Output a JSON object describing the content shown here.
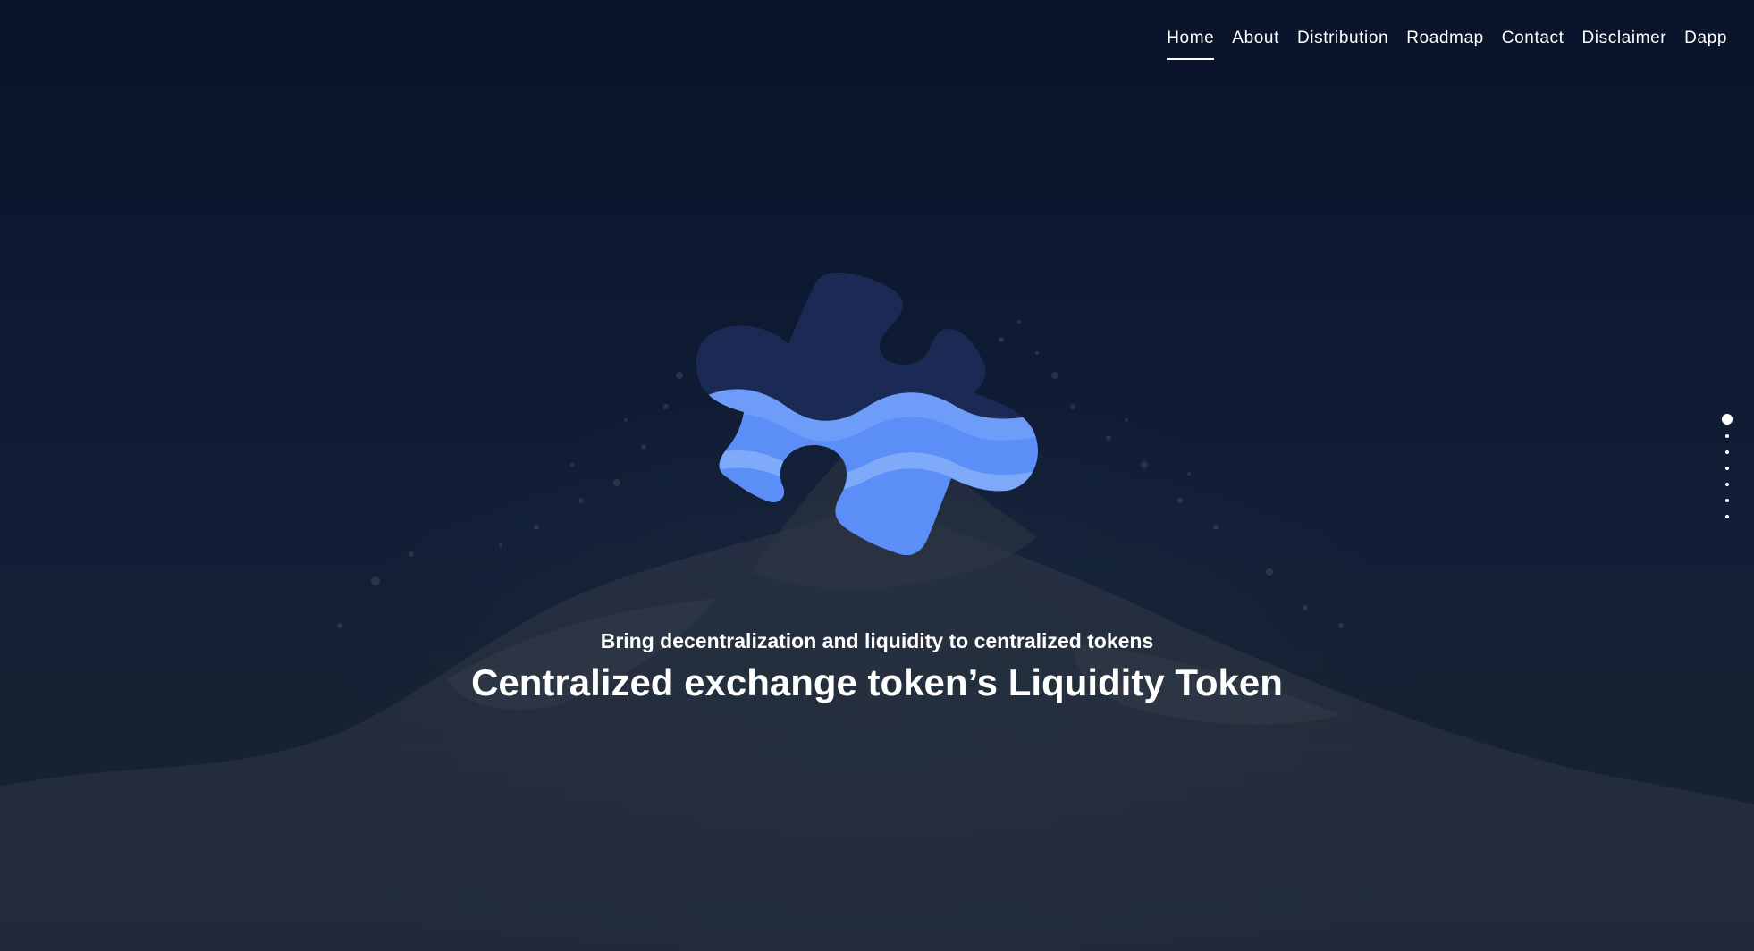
{
  "nav": {
    "items": [
      {
        "label": "Home",
        "active": true
      },
      {
        "label": "About"
      },
      {
        "label": "Distribution"
      },
      {
        "label": "Roadmap"
      },
      {
        "label": "Contact"
      },
      {
        "label": "Disclaimer"
      },
      {
        "label": "Dapp"
      }
    ]
  },
  "hero": {
    "subtitle": "Bring decentralization and liquidity to centralized tokens",
    "title": "Centralized exchange token’s Liquidity Token"
  },
  "section_dots": {
    "count": 7,
    "active_index": 0
  },
  "colors": {
    "background_top": "#09142a",
    "puzzle_dark": "#1a2a54",
    "puzzle_blue": "#5b8ef7",
    "puzzle_wave_light": "#7eaaf9",
    "text": "#ffffff"
  },
  "icons": {
    "logo": "puzzle-piece-wave-logo"
  }
}
